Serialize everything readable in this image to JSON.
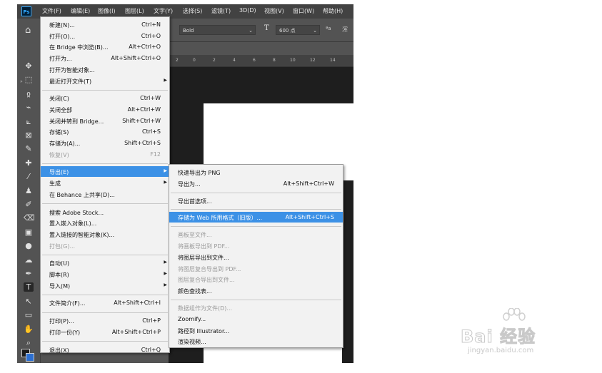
{
  "app": {
    "logo": "Ps",
    "menubar": [
      "文件(F)",
      "编辑(E)",
      "图像(I)",
      "图层(L)",
      "文字(Y)",
      "选择(S)",
      "滤镜(T)",
      "3D(D)",
      "视图(V)",
      "窗口(W)",
      "帮助(H)"
    ]
  },
  "options_bar": {
    "font_style": "Bold",
    "font_size": "600 点",
    "aa_label": "ªa",
    "tail": "浑"
  },
  "ruler_ticks": [
    "2",
    "0",
    "2",
    "4",
    "6",
    "8",
    "10",
    "12",
    "14"
  ],
  "file_menu": [
    {
      "label": "新建(N)...",
      "shortcut": "Ctrl+N"
    },
    {
      "label": "打开(O)...",
      "shortcut": "Ctrl+O"
    },
    {
      "label": "在 Bridge 中浏览(B)...",
      "shortcut": "Alt+Ctrl+O"
    },
    {
      "label": "打开为...",
      "shortcut": "Alt+Shift+Ctrl+O"
    },
    {
      "label": "打开为智能对象..."
    },
    {
      "label": "最近打开文件(T)",
      "submenu": true
    },
    {
      "separator": true
    },
    {
      "label": "关闭(C)",
      "shortcut": "Ctrl+W"
    },
    {
      "label": "关闭全部",
      "shortcut": "Alt+Ctrl+W"
    },
    {
      "label": "关闭并转到 Bridge...",
      "shortcut": "Shift+Ctrl+W"
    },
    {
      "label": "存储(S)",
      "shortcut": "Ctrl+S"
    },
    {
      "label": "存储为(A)...",
      "shortcut": "Shift+Ctrl+S"
    },
    {
      "label": "恢复(V)",
      "shortcut": "F12",
      "disabled": true
    },
    {
      "separator": true
    },
    {
      "label": "导出(E)",
      "submenu": true,
      "highlighted": true
    },
    {
      "label": "生成",
      "submenu": true
    },
    {
      "label": "在 Behance 上共享(D)..."
    },
    {
      "separator": true
    },
    {
      "label": "搜索 Adobe Stock..."
    },
    {
      "label": "置入嵌入对象(L)..."
    },
    {
      "label": "置入链接的智能对象(K)..."
    },
    {
      "label": "打包(G)...",
      "disabled": true
    },
    {
      "separator": true
    },
    {
      "label": "自动(U)",
      "submenu": true
    },
    {
      "label": "脚本(R)",
      "submenu": true
    },
    {
      "label": "导入(M)",
      "submenu": true
    },
    {
      "separator": true
    },
    {
      "label": "文件简介(F)...",
      "shortcut": "Alt+Shift+Ctrl+I"
    },
    {
      "separator": true
    },
    {
      "label": "打印(P)...",
      "shortcut": "Ctrl+P"
    },
    {
      "label": "打印一份(Y)",
      "shortcut": "Alt+Shift+Ctrl+P"
    },
    {
      "separator": true
    },
    {
      "label": "退出(X)",
      "shortcut": "Ctrl+Q"
    }
  ],
  "export_menu": [
    {
      "label": "快速导出为 PNG"
    },
    {
      "label": "导出为...",
      "shortcut": "Alt+Shift+Ctrl+W"
    },
    {
      "separator": true
    },
    {
      "label": "导出首选项..."
    },
    {
      "separator": true
    },
    {
      "label": "存储为 Web 所用格式（旧版）...",
      "shortcut": "Alt+Shift+Ctrl+S",
      "highlighted": true
    },
    {
      "separator": true
    },
    {
      "label": "画板至文件...",
      "disabled": true
    },
    {
      "label": "将画板导出到 PDF...",
      "disabled": true
    },
    {
      "label": "将图层导出到文件..."
    },
    {
      "label": "将图层复合导出到 PDF...",
      "disabled": true
    },
    {
      "label": "图层复合导出到文件...",
      "disabled": true
    },
    {
      "label": "颜色查找表..."
    },
    {
      "separator": true
    },
    {
      "label": "数据组作为文件(D)...",
      "disabled": true
    },
    {
      "label": "Zoomify..."
    },
    {
      "label": "路径到 Illustrator..."
    },
    {
      "label": "渲染视频..."
    }
  ],
  "tools": [
    "✥",
    "⬚",
    "ჲ",
    "⌁",
    "⟀",
    "⊠",
    "✎",
    "✚",
    "⁄",
    "♟",
    "✐",
    "⌫",
    "▣",
    "●",
    "☁",
    "✒",
    "T",
    "↖",
    "▭",
    "✋",
    "⌕"
  ],
  "tool_names": [
    "move-tool-icon",
    "marquee-tool-icon",
    "lasso-tool-icon",
    "quick-select-tool-icon",
    "crop-tool-icon",
    "frame-tool-icon",
    "eyedropper-tool-icon",
    "healing-tool-icon",
    "brush-tool-icon",
    "stamp-tool-icon",
    "history-brush-tool-icon",
    "eraser-tool-icon",
    "gradient-tool-icon",
    "blur-tool-icon",
    "dodge-tool-icon",
    "pen-tool-icon",
    "type-tool-icon",
    "path-select-tool-icon",
    "shape-tool-icon",
    "hand-tool-icon",
    "zoom-tool-icon"
  ],
  "watermark": {
    "brand": "Bai 经验",
    "url": "jingyan.baidu.com"
  },
  "colors": {
    "highlight": "#3c91e6",
    "foreground": "#1a1a1a",
    "background": "#2c6fd1"
  }
}
